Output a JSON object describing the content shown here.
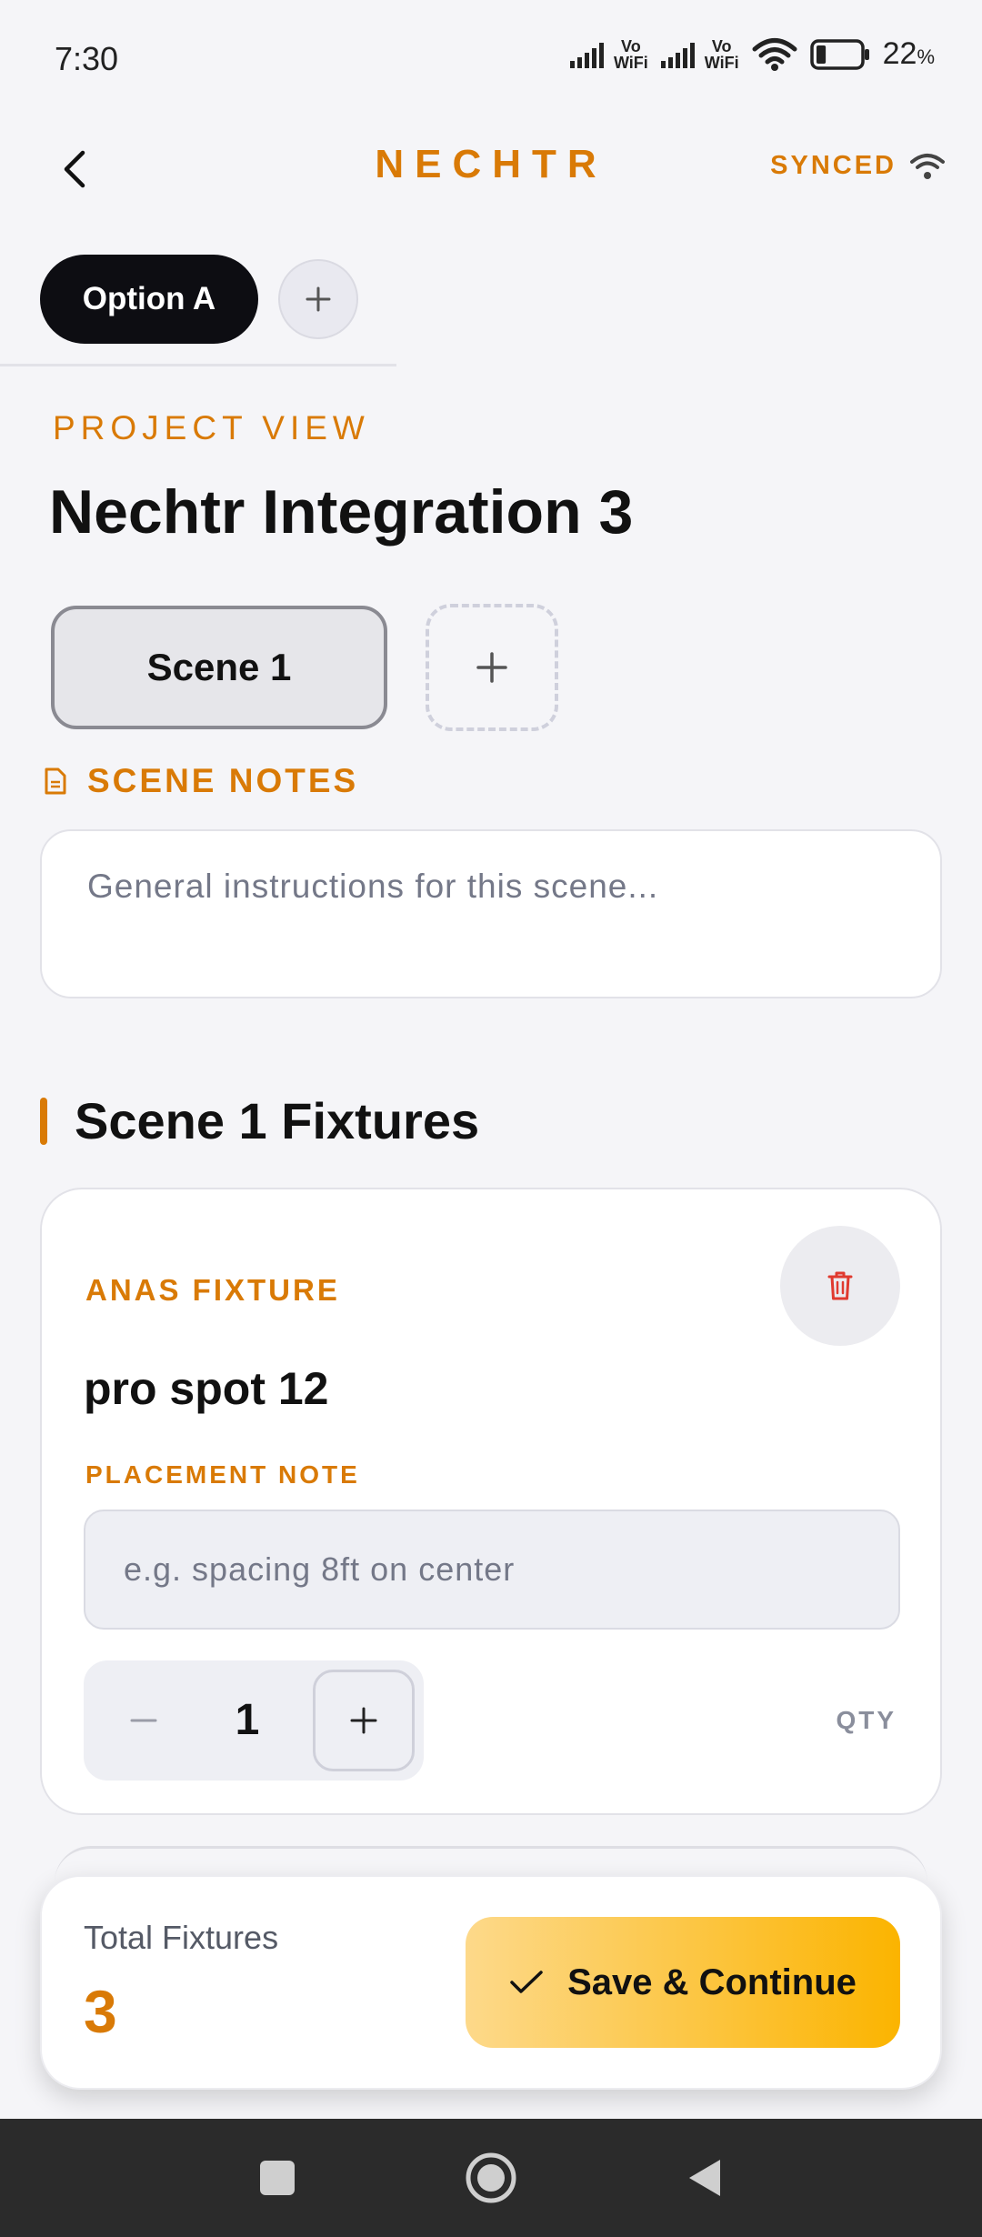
{
  "status_bar": {
    "time": "7:30",
    "vowifi_1_top": "Vo",
    "vowifi_1_bottom": "WiFi",
    "vowifi_2_top": "Vo",
    "vowifi_2_bottom": "WiFi",
    "battery_level": "22",
    "battery_unit": "%",
    "battery_fraction": 0.22
  },
  "header": {
    "brand": "NECHTR",
    "sync_label": "SYNCED"
  },
  "options": {
    "active_label": "Option A"
  },
  "project": {
    "section_label": "PROJECT VIEW",
    "title": "Nechtr Integration 3"
  },
  "scenes": {
    "active_label": "Scene 1"
  },
  "notes": {
    "label": "SCENE NOTES",
    "placeholder": "General instructions for this scene..."
  },
  "fixtures": {
    "heading": "Scene 1 Fixtures",
    "items": [
      {
        "type": "ANAS FIXTURE",
        "name": "pro spot 12",
        "placement_label": "PLACEMENT NOTE",
        "placement_placeholder": "e.g. spacing 8ft on center",
        "quantity": "1",
        "qty_label": "QTY"
      }
    ]
  },
  "summary": {
    "total_label": "Total Fixtures",
    "total_value": "3",
    "save_label": "Save & Continue"
  },
  "colors": {
    "accent": "#d97a06",
    "primary_dark": "#0d0d12",
    "delete_red": "#e03a2f",
    "save_gradient_start": "#fdd98a",
    "save_gradient_end": "#fbb400"
  },
  "icons": {
    "back": "chevron-left-icon",
    "wifi": "wifi-icon",
    "add": "plus-icon",
    "notes": "document-icon",
    "delete": "trash-icon",
    "decrement": "minus-icon",
    "confirm": "check-icon"
  }
}
